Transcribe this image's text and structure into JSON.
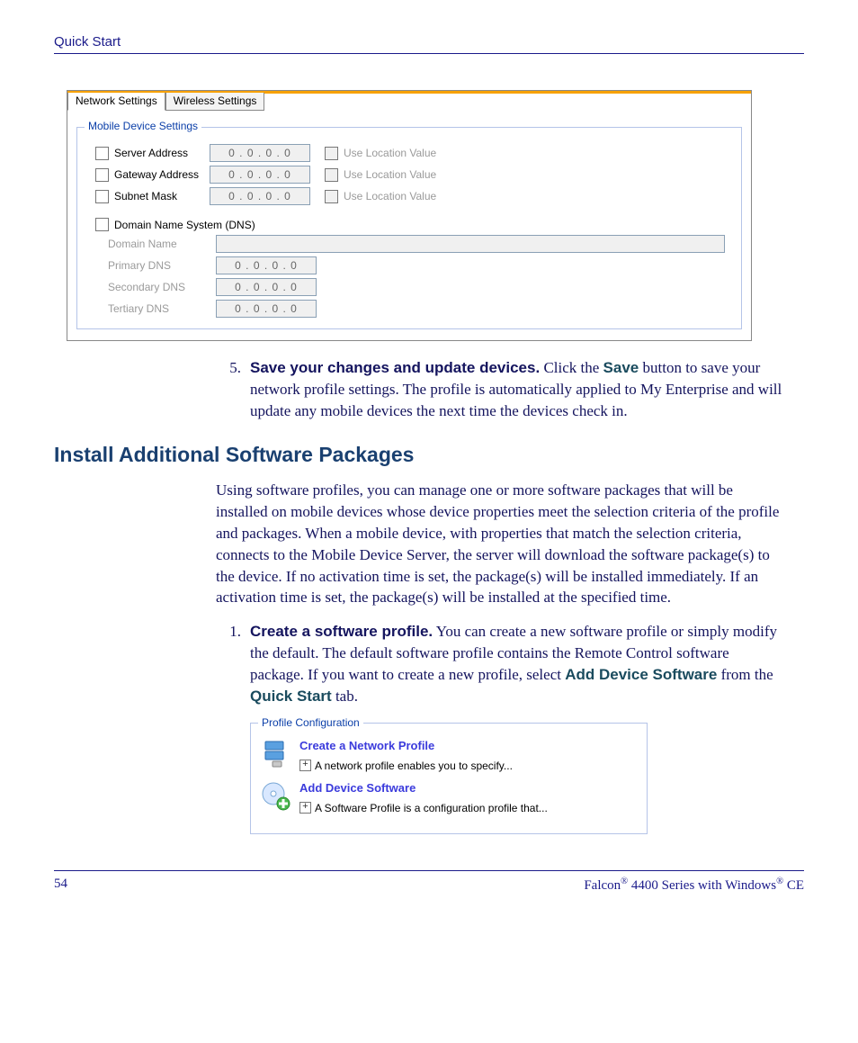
{
  "header": {
    "running": "Quick Start"
  },
  "network_pane": {
    "tabs": {
      "active": "Network Settings",
      "wireless": "Wireless Settings"
    },
    "fieldset_legend": "Mobile Device Settings",
    "rows": {
      "server_address": {
        "label": "Server Address",
        "ip": "0 . 0 . 0 . 0",
        "use_loc": "Use Location Value"
      },
      "gateway_address": {
        "label": "Gateway Address",
        "ip": "0 . 0 . 0 . 0",
        "use_loc": "Use Location Value"
      },
      "subnet_mask": {
        "label": "Subnet Mask",
        "ip": "0 . 0 . 0 . 0",
        "use_loc": "Use Location Value"
      },
      "dns_row": {
        "label": "Domain Name System (DNS)"
      },
      "domain_name": {
        "label": "Domain Name"
      },
      "primary_dns": {
        "label": "Primary DNS",
        "ip": "0 . 0 . 0 . 0"
      },
      "secondary_dns": {
        "label": "Secondary DNS",
        "ip": "0 . 0 . 0 . 0"
      },
      "tertiary_dns": {
        "label": "Tertiary DNS",
        "ip": "0 . 0 . 0 . 0"
      }
    }
  },
  "step5": {
    "num": "5.",
    "bold": "Save your changes and update devices.",
    "rest_a": " Click the ",
    "save_word": "Save",
    "rest_b": " button to save your network profile settings. The profile is automatically applied to My Enterprise and will update any mobile devices the next time the devices check in."
  },
  "section_heading": "Install Additional Software Packages",
  "intro_para": "Using software profiles, you can manage one or more software packages that will be installed on mobile devices whose device properties meet the selection criteria of the profile and packages. When a mobile device, with properties that match the selection criteria, connects to the Mobile Device Server, the server will download the software package(s) to the device. If no activation time is set, the package(s) will be installed immediately. If an activation time is set, the package(s) will be installed at the specified time.",
  "step1": {
    "num": "1.",
    "bold": "Create a software profile.",
    "rest_a": " You can create a new software profile or simply modify the default. The default software profile contains the Remote Control software package. If you want to create a new profile, select ",
    "add_dev": "Add Device Software",
    "rest_b": " from the ",
    "quick_start": "Quick Start",
    "rest_c": " tab."
  },
  "profile_config": {
    "legend": "Profile Configuration",
    "item1": {
      "title": "Create a Network Profile",
      "desc": "A network profile enables you to specify...",
      "plus": "+"
    },
    "item2": {
      "title": "Add Device Software",
      "desc": "A Software Profile is a configuration profile that...",
      "plus": "+"
    }
  },
  "footer": {
    "page_num": "54",
    "product_a": "Falcon",
    "reg": "®",
    "product_b": " 4400 Series with Windows",
    "product_c": " CE"
  }
}
